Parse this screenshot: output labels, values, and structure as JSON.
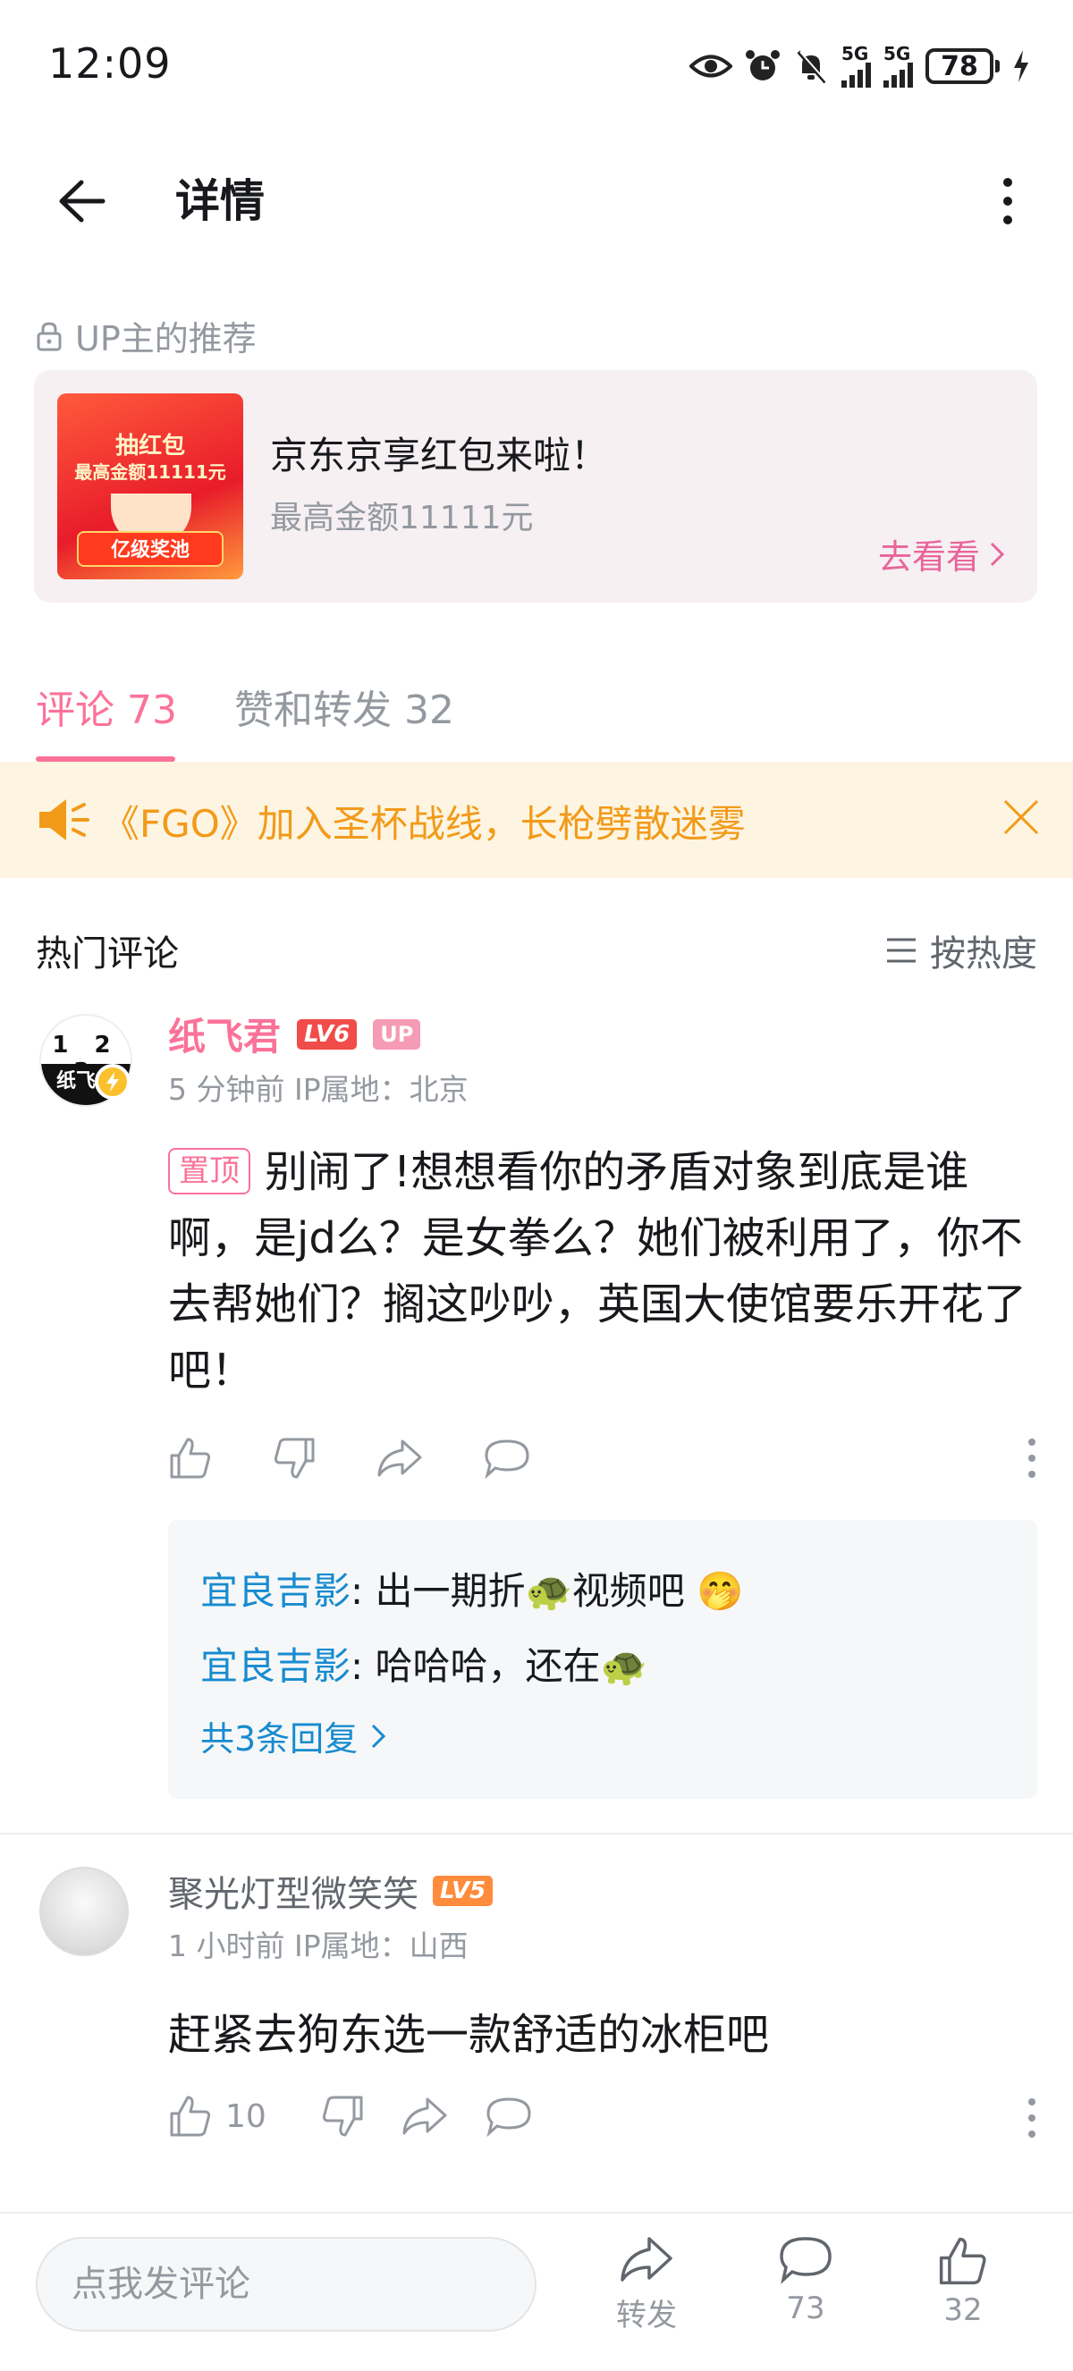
{
  "status": {
    "time": "12:09",
    "battery": "78",
    "net1": "5G",
    "net2": "5G"
  },
  "header": {
    "title": "详情"
  },
  "recommend": {
    "label": "UP主的推荐",
    "thumb_line1": "抽红包",
    "thumb_line2": "最高金额11111元",
    "thumb_line3": "亿级奖池",
    "title": "京东京享红包来啦！",
    "subtitle": "最高金额11111元",
    "go": "去看看"
  },
  "tabs": [
    {
      "label": "评论 73",
      "active": true
    },
    {
      "label": "赞和转发 32",
      "active": false
    }
  ],
  "notice": {
    "text": "《FGO》加入圣杯战线，长枪劈散迷雾"
  },
  "hot": {
    "title": "热门评论",
    "sort": "按热度"
  },
  "comments": [
    {
      "user": "纸飞君",
      "level": "LV6",
      "badge": "UP",
      "avatar_text": "1 2 3",
      "avatar_bar": "纸飞机",
      "meta": "5 分钟前  IP属地：北京",
      "pin": "置顶",
      "text": "别闹了!想想看你的矛盾对象到底是谁啊，是jd么？是女拳么？她们被利用了，你不去帮她们？搁这吵吵，英国大使馆要乐开花了吧！",
      "replies": [
        {
          "name": "宜良吉影",
          "text": ": 出一期折🐢视频吧 🤭"
        },
        {
          "name": "宜良吉影",
          "text": ": 哈哈哈，还在🐢"
        }
      ],
      "more_replies": "共3条回复"
    },
    {
      "user": "聚光灯型微笑笑",
      "level": "LV5",
      "meta": "1 小时前  IP属地：山西",
      "text": "赶紧去狗东选一款舒适的冰柜吧",
      "likes": "10"
    }
  ],
  "bottom": {
    "placeholder": "点我发评论",
    "share": "转发",
    "comments": "73",
    "likes": "32"
  },
  "colors": {
    "accent": "#fb7299",
    "link": "#178bcf",
    "notice": "#f29a1a"
  }
}
